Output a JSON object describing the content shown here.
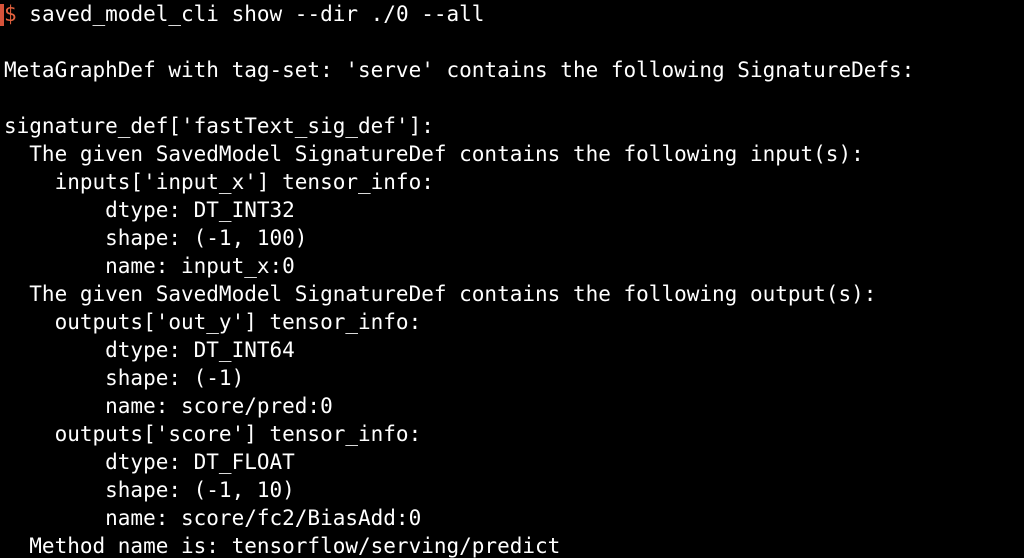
{
  "colors": {
    "background": "#000000",
    "text": "#ffffff",
    "prompt": "#e5623e"
  },
  "prompt": {
    "symbol": "$",
    "command": " saved_model_cli show --dir ./0 --all"
  },
  "output": {
    "metagraph": "MetaGraphDef with tag-set: 'serve' contains the following SignatureDefs:",
    "signature": "signature_def['fastText_sig_def']:",
    "inputs_header": "  The given SavedModel SignatureDef contains the following input(s):",
    "input_x": {
      "name_line": "    inputs['input_x'] tensor_info:",
      "dtype": "        dtype: DT_INT32",
      "shape": "        shape: (-1, 100)",
      "tensor": "        name: input_x:0"
    },
    "outputs_header": "  The given SavedModel SignatureDef contains the following output(s):",
    "out_y": {
      "name_line": "    outputs['out_y'] tensor_info:",
      "dtype": "        dtype: DT_INT64",
      "shape": "        shape: (-1)",
      "tensor": "        name: score/pred:0"
    },
    "score": {
      "name_line": "    outputs['score'] tensor_info:",
      "dtype": "        dtype: DT_FLOAT",
      "shape": "        shape: (-1, 10)",
      "tensor": "        name: score/fc2/BiasAdd:0"
    },
    "method": "  Method name is: tensorflow/serving/predict"
  }
}
